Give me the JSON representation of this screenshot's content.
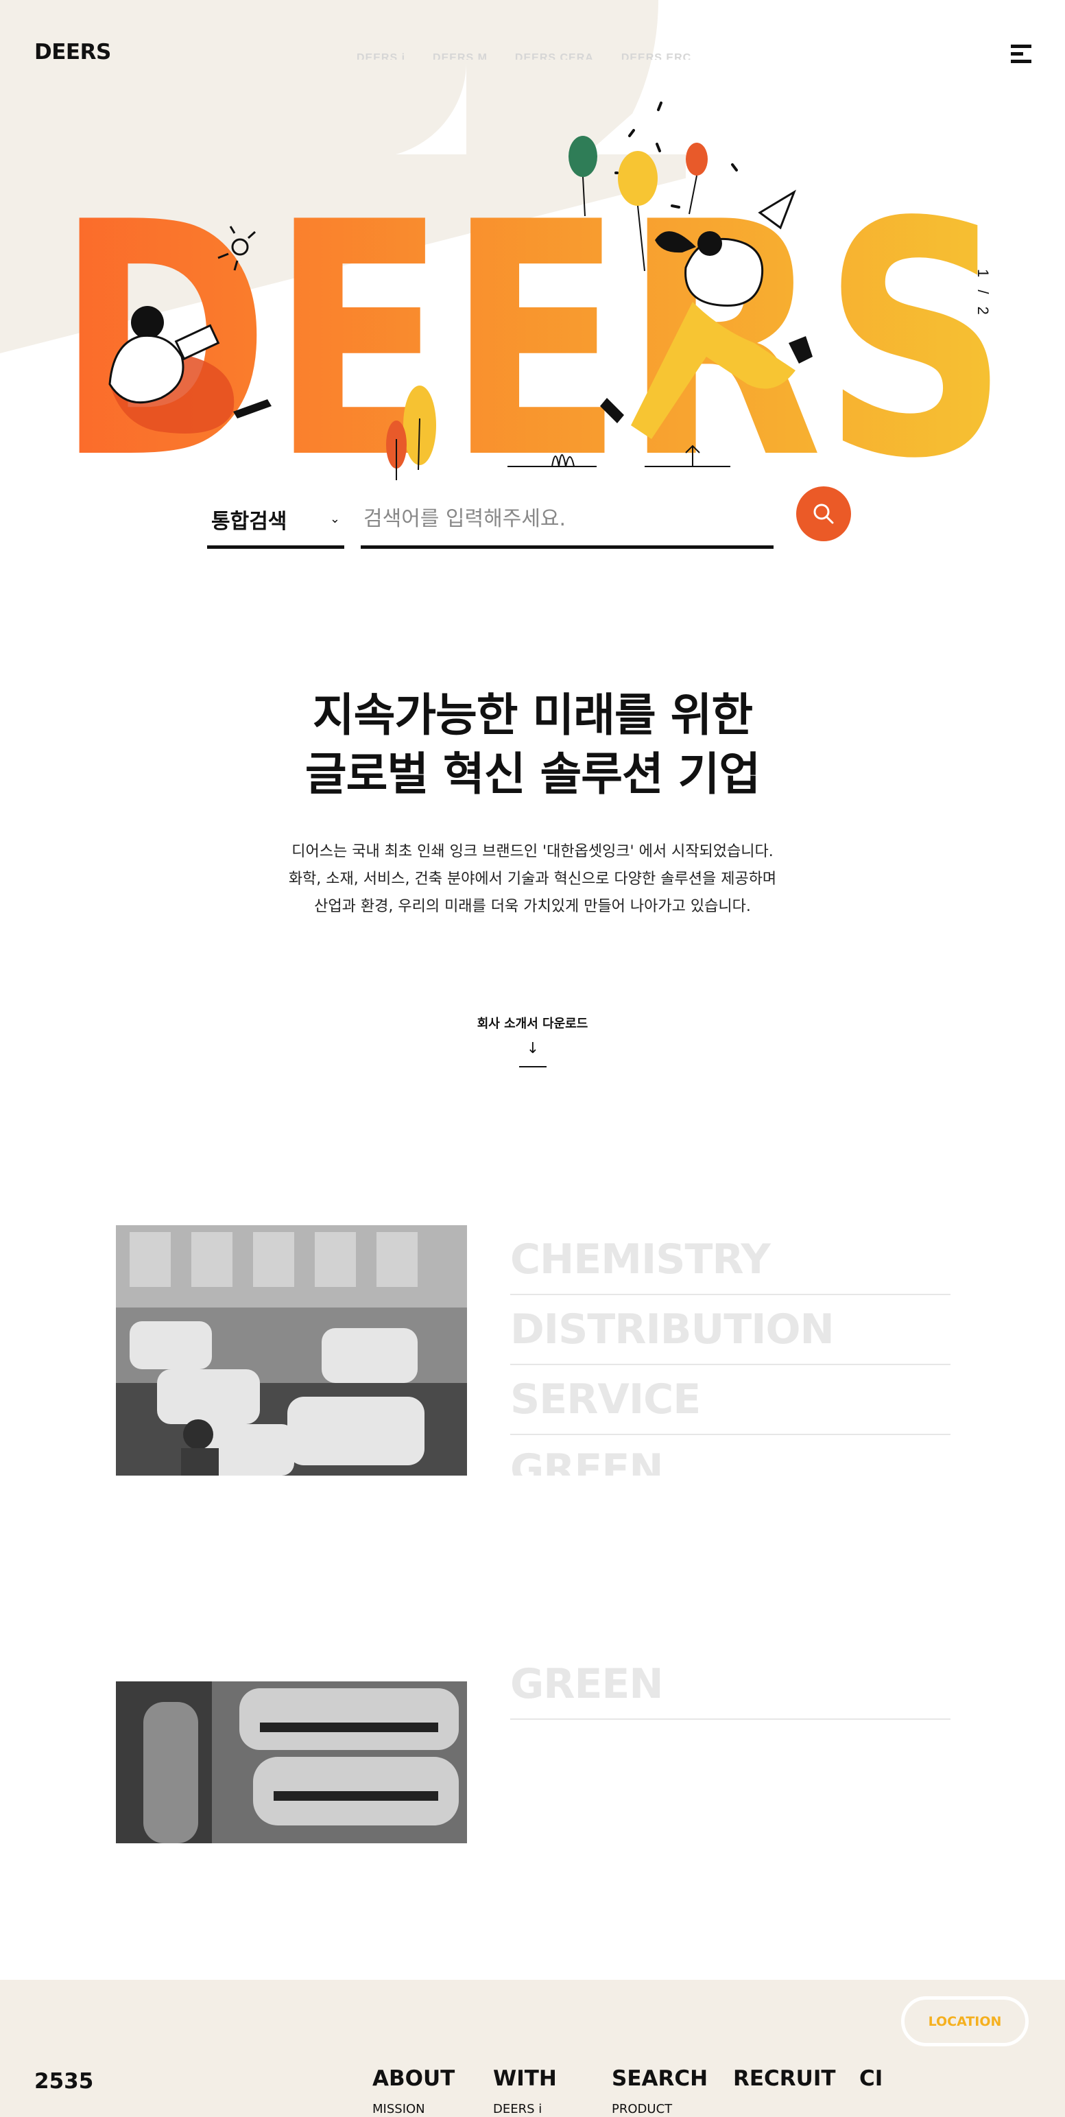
{
  "header": {
    "logo": "DEERS",
    "nav": [
      "DEERS i",
      "DEERS M",
      "DEERS CERA",
      "DEERS ERC"
    ]
  },
  "hero": {
    "wordmark": "DEERS",
    "pager": "1 / 2",
    "colors": {
      "start": "#fb6a2b",
      "end": "#f6c232",
      "balloon_green": "#2f7d57",
      "balloon_yellow": "#f7c533",
      "balloon_red": "#e85a2a"
    }
  },
  "search": {
    "category": "통합검색",
    "placeholder": "검색어를 입력해주세요.",
    "button_color": "#eb5a27"
  },
  "intro": {
    "headline_1": "지속가능한 미래를 위한",
    "headline_2": "글로벌 혁신 솔루션 기업",
    "text_1": "디어스는 국내 최초 인쇄 잉크 브랜드인 '대한옵셋잉크' 에서 시작되었습니다.",
    "text_2": "화학, 소재, 서비스, 건축 분야에서 기술과 혁신으로 다양한 솔루션을 제공하며",
    "text_3": "산업과 환경, 우리의 미래를 더욱 가치있게 만들어 나아가고 있습니다.",
    "download": "회사 소개서 다운로드",
    "download_arrow": "↓"
  },
  "business": {
    "items": [
      "CHEMISTRY",
      "DISTRIBUTION",
      "SERVICE",
      "GREEN"
    ]
  },
  "footer": {
    "number": "2535",
    "columns": [
      {
        "title": "ABOUT",
        "sub": "MISSION"
      },
      {
        "title": "WITH",
        "sub": "DEERS i"
      },
      {
        "title": "SEARCH",
        "sub": "PRODUCT"
      },
      {
        "title": "RECRUIT",
        "sub": ""
      },
      {
        "title": "CI",
        "sub": ""
      }
    ],
    "location": "LOCATION"
  }
}
